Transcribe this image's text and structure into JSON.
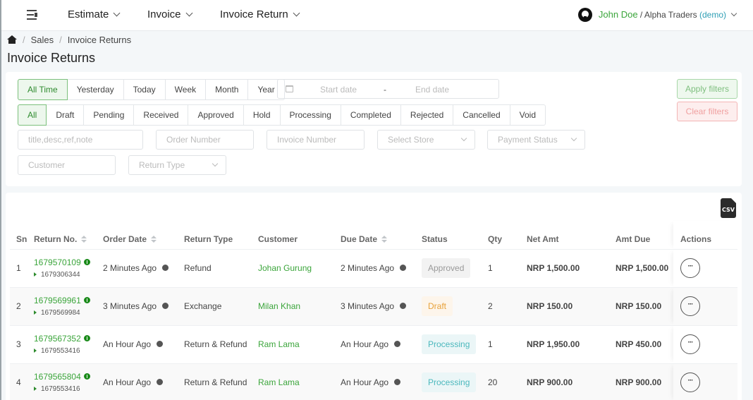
{
  "nav": {
    "items": [
      {
        "label": "Estimate"
      },
      {
        "label": "Invoice"
      },
      {
        "label": "Invoice Return"
      }
    ],
    "user": {
      "name": "John Doe",
      "separator": " / ",
      "company": "Alpha Traders",
      "tag": "(demo)"
    }
  },
  "breadcrumb": {
    "items": [
      "Sales",
      "Invoice Returns"
    ],
    "separator": "/"
  },
  "page_title": "Invoice Returns",
  "filters": {
    "time_ranges": [
      "All Time",
      "Yesterday",
      "Today",
      "Week",
      "Month",
      "Year"
    ],
    "active_time_range": "All Time",
    "date_range": {
      "start_placeholder": "Start date",
      "separator": "-",
      "end_placeholder": "End date"
    },
    "statuses": [
      "All",
      "Draft",
      "Pending",
      "Received",
      "Approved",
      "Hold",
      "Processing",
      "Completed",
      "Rejected",
      "Cancelled",
      "Void"
    ],
    "active_status": "All",
    "search_placeholder": "title,desc,ref,note",
    "order_number_placeholder": "Order Number",
    "invoice_number_placeholder": "Invoice Number",
    "store_placeholder": "Select Store",
    "payment_status_placeholder": "Payment Status",
    "customer_placeholder": "Customer",
    "return_type_placeholder": "Return Type",
    "apply_label": "Apply filters",
    "clear_label": "Clear filters"
  },
  "table": {
    "export_label": "CSV",
    "columns": [
      "Sn",
      "Return No.",
      "Order Date",
      "Return Type",
      "Customer",
      "Due Date",
      "Status",
      "Qty",
      "Net Amt",
      "Amt Due",
      "Actions"
    ],
    "rows": [
      {
        "sn": "1",
        "return_no": "1679570109",
        "invoice_ref": "1679306344",
        "order_date": "2 Minutes Ago",
        "return_type": "Refund",
        "customer": "Johan Gurung",
        "due_date": "2 Minutes Ago",
        "status": "Approved",
        "qty": "1",
        "net_amt": "NRP 1,500.00",
        "amt_due": "NRP 1,500.00"
      },
      {
        "sn": "2",
        "return_no": "1679569961",
        "invoice_ref": "1679569984",
        "order_date": "3 Minutes Ago",
        "return_type": "Exchange",
        "customer": "Milan Khan",
        "due_date": "3 Minutes Ago",
        "status": "Draft",
        "qty": "2",
        "net_amt": "NRP 150.00",
        "amt_due": "NRP 150.00"
      },
      {
        "sn": "3",
        "return_no": "1679567352",
        "invoice_ref": "1679553416",
        "order_date": "An Hour Ago",
        "return_type": "Return & Refund",
        "customer": "Ram Lama",
        "due_date": "An Hour Ago",
        "status": "Processing",
        "qty": "1",
        "net_amt": "NRP 1,950.00",
        "amt_due": "NRP 450.00"
      },
      {
        "sn": "4",
        "return_no": "1679565804",
        "invoice_ref": "1679553416",
        "order_date": "An Hour Ago",
        "return_type": "Return & Refund",
        "customer": "Ram Lama",
        "due_date": "An Hour Ago",
        "status": "Processing",
        "qty": "20",
        "net_amt": "NRP 900.00",
        "amt_due": "NRP 900.00"
      }
    ],
    "more_label": "···"
  },
  "colors": {
    "accent_green": "#3ba53b",
    "approved": "#999999",
    "draft": "#e8a13a",
    "processing": "#4bb8bd"
  }
}
